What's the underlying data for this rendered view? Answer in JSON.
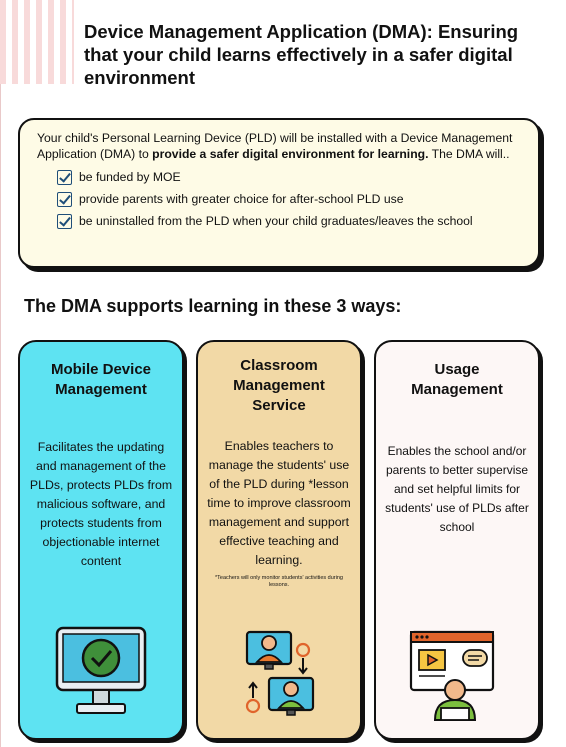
{
  "header": {
    "title": "Device Management Application (DMA): Ensuring that your child learns effectively in a safer digital environment"
  },
  "intro": {
    "text_part1": "Your child's Personal Learning Device (PLD) will be installed with a Device Management Application (DMA) to ",
    "text_bold": "provide a safer digital environment for learning.",
    "text_part2": " The DMA will..",
    "checklist": [
      "be funded by MOE",
      "provide parents with greater choice for after-school PLD use",
      "be uninstalled from the PLD when your child graduates/leaves the school"
    ]
  },
  "section": {
    "heading": "The DMA supports learning in these 3 ways:"
  },
  "cards": [
    {
      "title": "Mobile Device Management",
      "body": "Facilitates the updating and management of the PLDs, protects PLDs from malicious software, and protects students from objectionable internet content",
      "icon": "monitor-check-icon",
      "color": "#5ee3f2"
    },
    {
      "title": "Classroom Management Service",
      "body": "Enables teachers to manage the students' use of the PLD during *lesson time to improve classroom management and support effective teaching and learning.",
      "note": "*Teachers will only monitor students' activities during lessons.",
      "icon": "teacher-students-screens-icon",
      "color": "#f2d9a6"
    },
    {
      "title": "Usage Management",
      "body": "Enables the school and/or parents to better supervise and set helpful limits for students' use of PLDs after school",
      "icon": "student-laptop-video-icon",
      "color": "#fdf7f6"
    }
  ]
}
